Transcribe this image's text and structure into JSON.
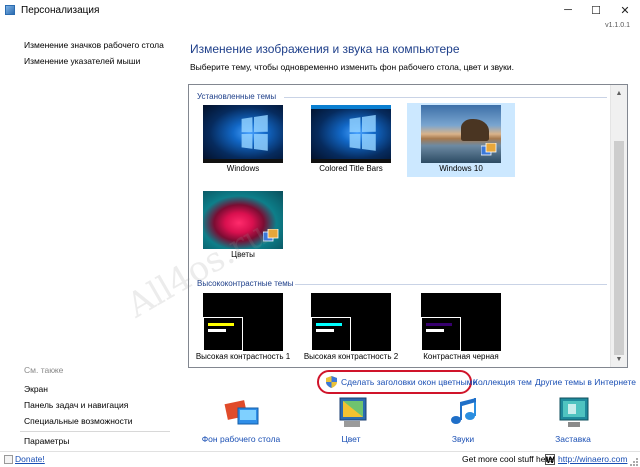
{
  "window": {
    "title": "Персонализация",
    "version": "v1.1.0.1",
    "controls": {
      "minimize": "─",
      "maximize": "☐",
      "close": "✕"
    }
  },
  "sidebar": {
    "links": [
      "Изменение значков рабочего стола",
      "Изменение указателей мыши"
    ],
    "see_also_title": "См. также",
    "see_also": [
      "Экран",
      "Панель задач и навигация",
      "Специальные возможности"
    ],
    "settings": "Параметры"
  },
  "main": {
    "heading": "Изменение изображения и звука на компьютере",
    "description": "Выберите тему, чтобы одновременно изменить фон рабочего стола, цвет и звуки."
  },
  "themes": {
    "installed_title": "Установленные темы",
    "installed": [
      {
        "label": "Windows",
        "selected": false
      },
      {
        "label": "Colored Title Bars",
        "selected": false
      },
      {
        "label": "Windows 10",
        "selected": true
      },
      {
        "label": "Цветы",
        "selected": false
      }
    ],
    "high_contrast_title": "Высококонтрастные темы",
    "high_contrast": [
      {
        "label": "Высокая контрастность 1",
        "accent": "#ffff00"
      },
      {
        "label": "Высокая контрастность 2",
        "accent": "#00ffff"
      },
      {
        "label": "Контрастная черная",
        "accent": "#37006e"
      }
    ]
  },
  "links": {
    "colored_titlebars": "Сделать заголовки окон цветными",
    "collection": "Коллекция тем",
    "online": "Другие темы в Интернете"
  },
  "bottom": [
    {
      "label": "Фон рабочего стола",
      "icon": "desktop-background-icon"
    },
    {
      "label": "Цвет",
      "icon": "color-icon"
    },
    {
      "label": "Звуки",
      "icon": "sounds-icon"
    },
    {
      "label": "Заставка",
      "icon": "screensaver-icon"
    }
  ],
  "status": {
    "donate": "Donate!",
    "cool_text": "Get more cool stuff here:",
    "w_letter": "W",
    "site": "http://winaero.com"
  },
  "watermark": "All4os.ru",
  "colors": {
    "link": "#1a4fb4",
    "heading": "#1e3f8a",
    "highlight": "#d0142a",
    "selection": "#cce8ff"
  }
}
